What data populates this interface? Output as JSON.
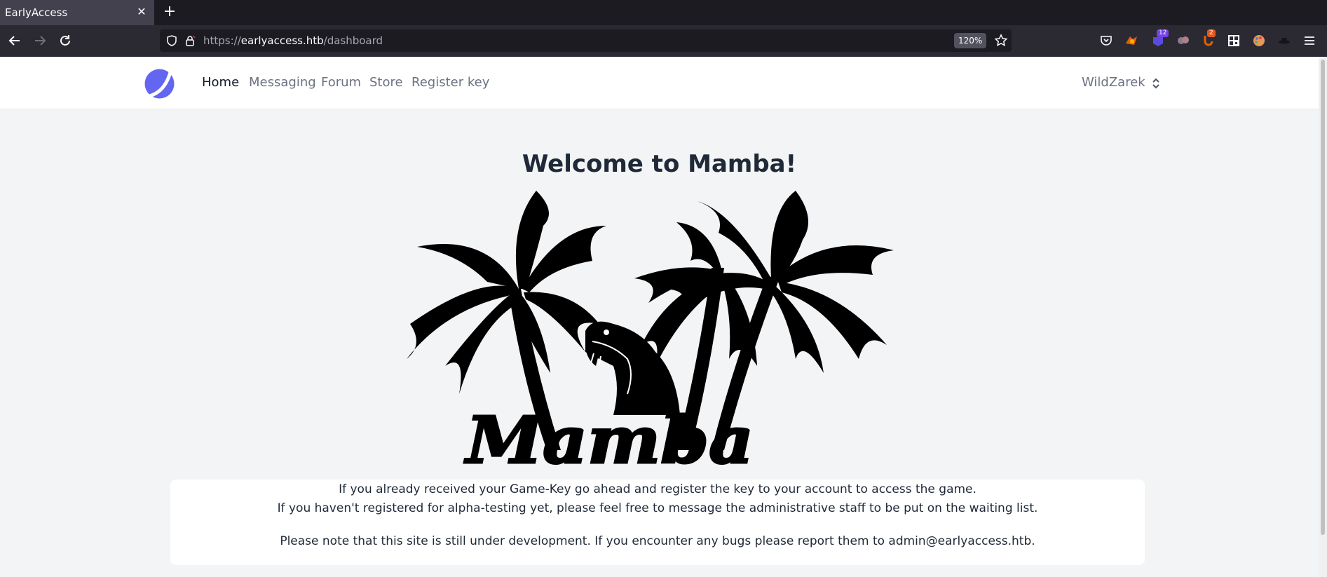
{
  "browser": {
    "tab_title": "EarlyAccess",
    "tab_close": "✕",
    "new_tab": "+",
    "url_prefix": "https://",
    "url_host": "earlyaccess.htb",
    "url_path": "/dashboard",
    "zoom": "120%",
    "badges": {
      "ext_purple": "12",
      "ext_orange": "2"
    }
  },
  "site": {
    "nav": [
      "Home",
      "Messaging",
      "Forum",
      "Store",
      "Register key"
    ],
    "active_nav": "Home",
    "user": "WildZarek",
    "accent": "#6366f1"
  },
  "main": {
    "welcome": "Welcome to Mamba!",
    "logo_text": "Mamba",
    "line1": "If you already received your Game-Key go ahead and register the key to your account to access the game.",
    "line2": "If you haven't registered for alpha-testing yet, please feel free to message the administrative staff to be put on the waiting list.",
    "line3": "Please note that this site is still under development. If you encounter any bugs please report them to admin@earlyaccess.htb."
  }
}
